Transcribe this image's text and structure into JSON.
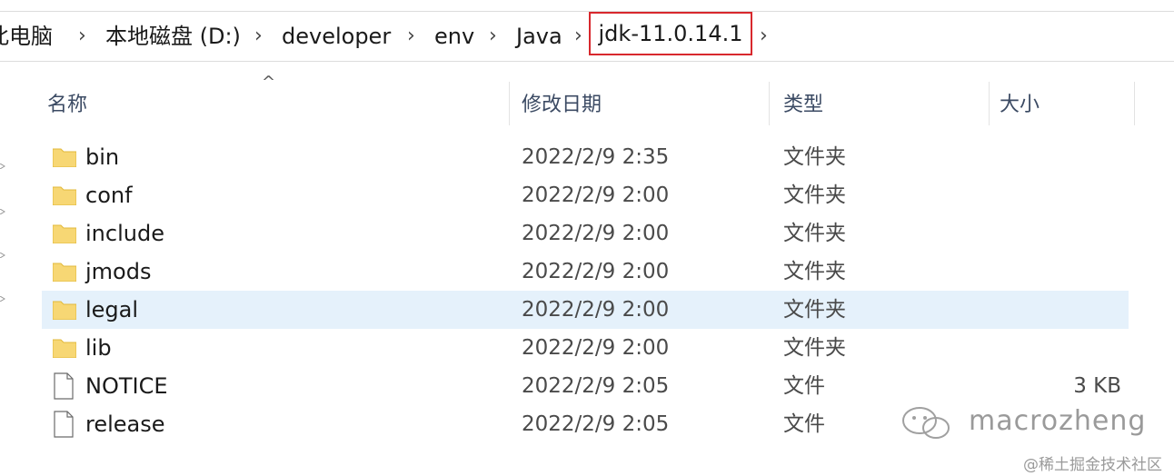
{
  "breadcrumb": {
    "items": [
      "此电脑",
      "本地磁盘 (D:)",
      "developer",
      "env",
      "Java"
    ],
    "current": "jdk-11.0.14.1",
    "separator": "›"
  },
  "columns": {
    "name": "名称",
    "modified": "修改日期",
    "type": "类型",
    "size": "大小"
  },
  "files": [
    {
      "name": "bin",
      "modified": "2022/2/9 2:35",
      "type": "文件夹",
      "size": "",
      "kind": "folder"
    },
    {
      "name": "conf",
      "modified": "2022/2/9 2:00",
      "type": "文件夹",
      "size": "",
      "kind": "folder"
    },
    {
      "name": "include",
      "modified": "2022/2/9 2:00",
      "type": "文件夹",
      "size": "",
      "kind": "folder"
    },
    {
      "name": "jmods",
      "modified": "2022/2/9 2:00",
      "type": "文件夹",
      "size": "",
      "kind": "folder"
    },
    {
      "name": "legal",
      "modified": "2022/2/9 2:00",
      "type": "文件夹",
      "size": "",
      "kind": "folder",
      "selected": true
    },
    {
      "name": "lib",
      "modified": "2022/2/9 2:00",
      "type": "文件夹",
      "size": "",
      "kind": "folder"
    },
    {
      "name": "NOTICE",
      "modified": "2022/2/9 2:05",
      "type": "文件",
      "size": "3 KB",
      "kind": "file"
    },
    {
      "name": "release",
      "modified": "2022/2/9 2:05",
      "type": "文件",
      "size": "",
      "kind": "file"
    }
  ],
  "watermark": {
    "text": "macrozheng",
    "site": "@稀土掘金技术社区"
  },
  "colors": {
    "highlight_border": "#d8282d",
    "selected_row": "#e5f1fb",
    "folder": "#f7d774"
  }
}
